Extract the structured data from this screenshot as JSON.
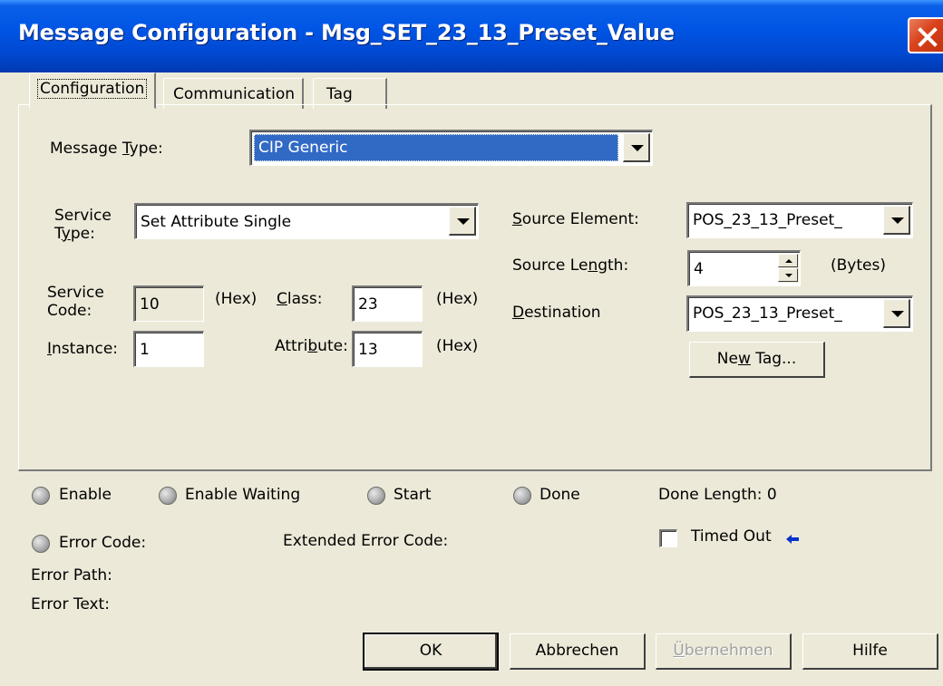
{
  "window": {
    "title": "Message Configuration - Msg_SET_23_13_Preset_Value"
  },
  "tabs": [
    "Configuration",
    "Communication",
    "Tag"
  ],
  "config": {
    "message_type_label_pre": "Message ",
    "message_type_label_u": "T",
    "message_type_label_post": "ype:",
    "message_type_value": "CIP Generic",
    "service_type_label_1": "Service",
    "service_type_label_2_u": "y",
    "service_type_label_2_pre": "T",
    "service_type_label_2_post": "pe:",
    "service_type_value": "Set Attribute Single",
    "service_code_label_1": "Service",
    "service_code_label_2": "Code:",
    "service_code_value": "10",
    "hex_1": "(Hex)",
    "class_label_u": "C",
    "class_label_post": "lass:",
    "class_value": "23",
    "hex_2": "(Hex)",
    "instance_label_u": "I",
    "instance_label_post": "nstance:",
    "instance_value": "1",
    "attribute_label_pre": "Attri",
    "attribute_label_u": "b",
    "attribute_label_post": "ute:",
    "attribute_value": "13",
    "hex_3": "(Hex)",
    "source_element_label_u": "S",
    "source_element_label_post": "ource Element:",
    "source_element_value": "POS_23_13_Preset_",
    "source_length_label_pre": "Source Le",
    "source_length_label_u": "n",
    "source_length_label_post": "gth:",
    "source_length_value": "4",
    "bytes": "(Bytes)",
    "destination_label_u": "D",
    "destination_label_post": "estination",
    "destination_value": "POS_23_13_Preset_",
    "new_tag_pre": "Ne",
    "new_tag_u": "w",
    "new_tag_post": " Tag..."
  },
  "status": {
    "enable": "Enable",
    "enable_waiting": "Enable Waiting",
    "start": "Start",
    "done": "Done",
    "done_length": "Done Length: 0",
    "error_code": "Error Code:",
    "extended_error_code": "Extended Error Code:",
    "timed_out": "Timed Out",
    "error_path": "Error Path:",
    "error_text": "Error Text:"
  },
  "buttons": {
    "ok": "OK",
    "cancel": "Abbrechen",
    "apply_u": "Ü",
    "apply_post": "bernehmen",
    "help": "Hilfe"
  },
  "colors": {
    "title_bar": "#0055e5",
    "selection": "#316ac5",
    "timed_out_arrow": "#0033cc"
  }
}
